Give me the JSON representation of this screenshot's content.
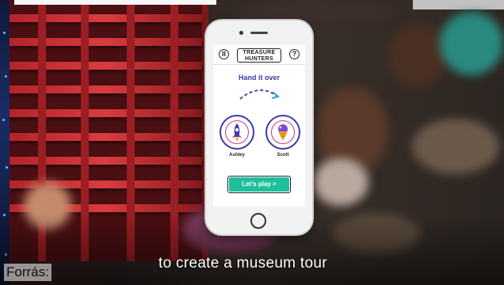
{
  "app": {
    "logo_line1": "TREASURE",
    "logo_line2": "HUNTERS",
    "pause_label": "II",
    "help_label": "?",
    "screen_title": "Hand it over",
    "player_from": "Ashley",
    "player_to": "Scott",
    "play_button": "Let's play  >"
  },
  "overlay": {
    "caption": "to create a museum tour",
    "source_label": "Forrás:"
  },
  "icons": {
    "from_avatar": "rocket-icon",
    "to_avatar": "ice-cream-icon",
    "arrow": "dashed-arc-arrow-icon"
  },
  "colors": {
    "brand_purple": "#3c3aa8",
    "accent_pink": "#c23a8a",
    "button_green": "#1fbf9b",
    "cabinet_red": "#b3232a"
  }
}
